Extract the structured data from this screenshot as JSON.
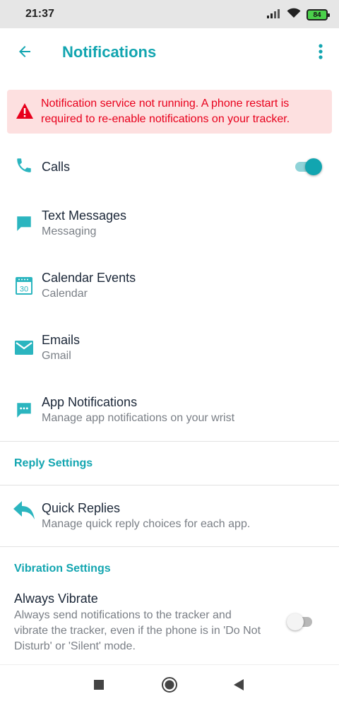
{
  "status_bar": {
    "time": "21:37",
    "battery": "84"
  },
  "header": {
    "title": "Notifications"
  },
  "alert": {
    "message": "Notification service not running. A phone restart is required to re-enable notifications on your tracker."
  },
  "notifications": [
    {
      "title": "Calls",
      "subtitle": "",
      "icon": "phone-icon",
      "toggle_on": true
    },
    {
      "title": "Text Messages",
      "subtitle": "Messaging",
      "icon": "message-icon"
    },
    {
      "title": "Calendar Events",
      "subtitle": "Calendar",
      "icon": "calendar-icon",
      "icon_text": "30"
    },
    {
      "title": "Emails",
      "subtitle": "Gmail",
      "icon": "email-icon"
    },
    {
      "title": "App Notifications",
      "subtitle": "Manage app notifications on your wrist",
      "icon": "app-notification-icon"
    }
  ],
  "reply_settings": {
    "header": "Reply Settings",
    "quick_replies": {
      "title": "Quick Replies",
      "subtitle": "Manage quick reply choices for each app.",
      "icon": "reply-icon"
    }
  },
  "vibration_settings": {
    "header": "Vibration Settings",
    "always_vibrate": {
      "title": "Always Vibrate",
      "description": "Always send notifications to the tracker and vibrate the tracker, even if the phone is in 'Do Not Disturb' or 'Silent' mode.",
      "toggle_on": false
    }
  },
  "colors": {
    "accent": "#12a5b0",
    "icon": "#2bb5bf",
    "alert_bg": "#fde0e0",
    "alert_text": "#e8001c"
  }
}
